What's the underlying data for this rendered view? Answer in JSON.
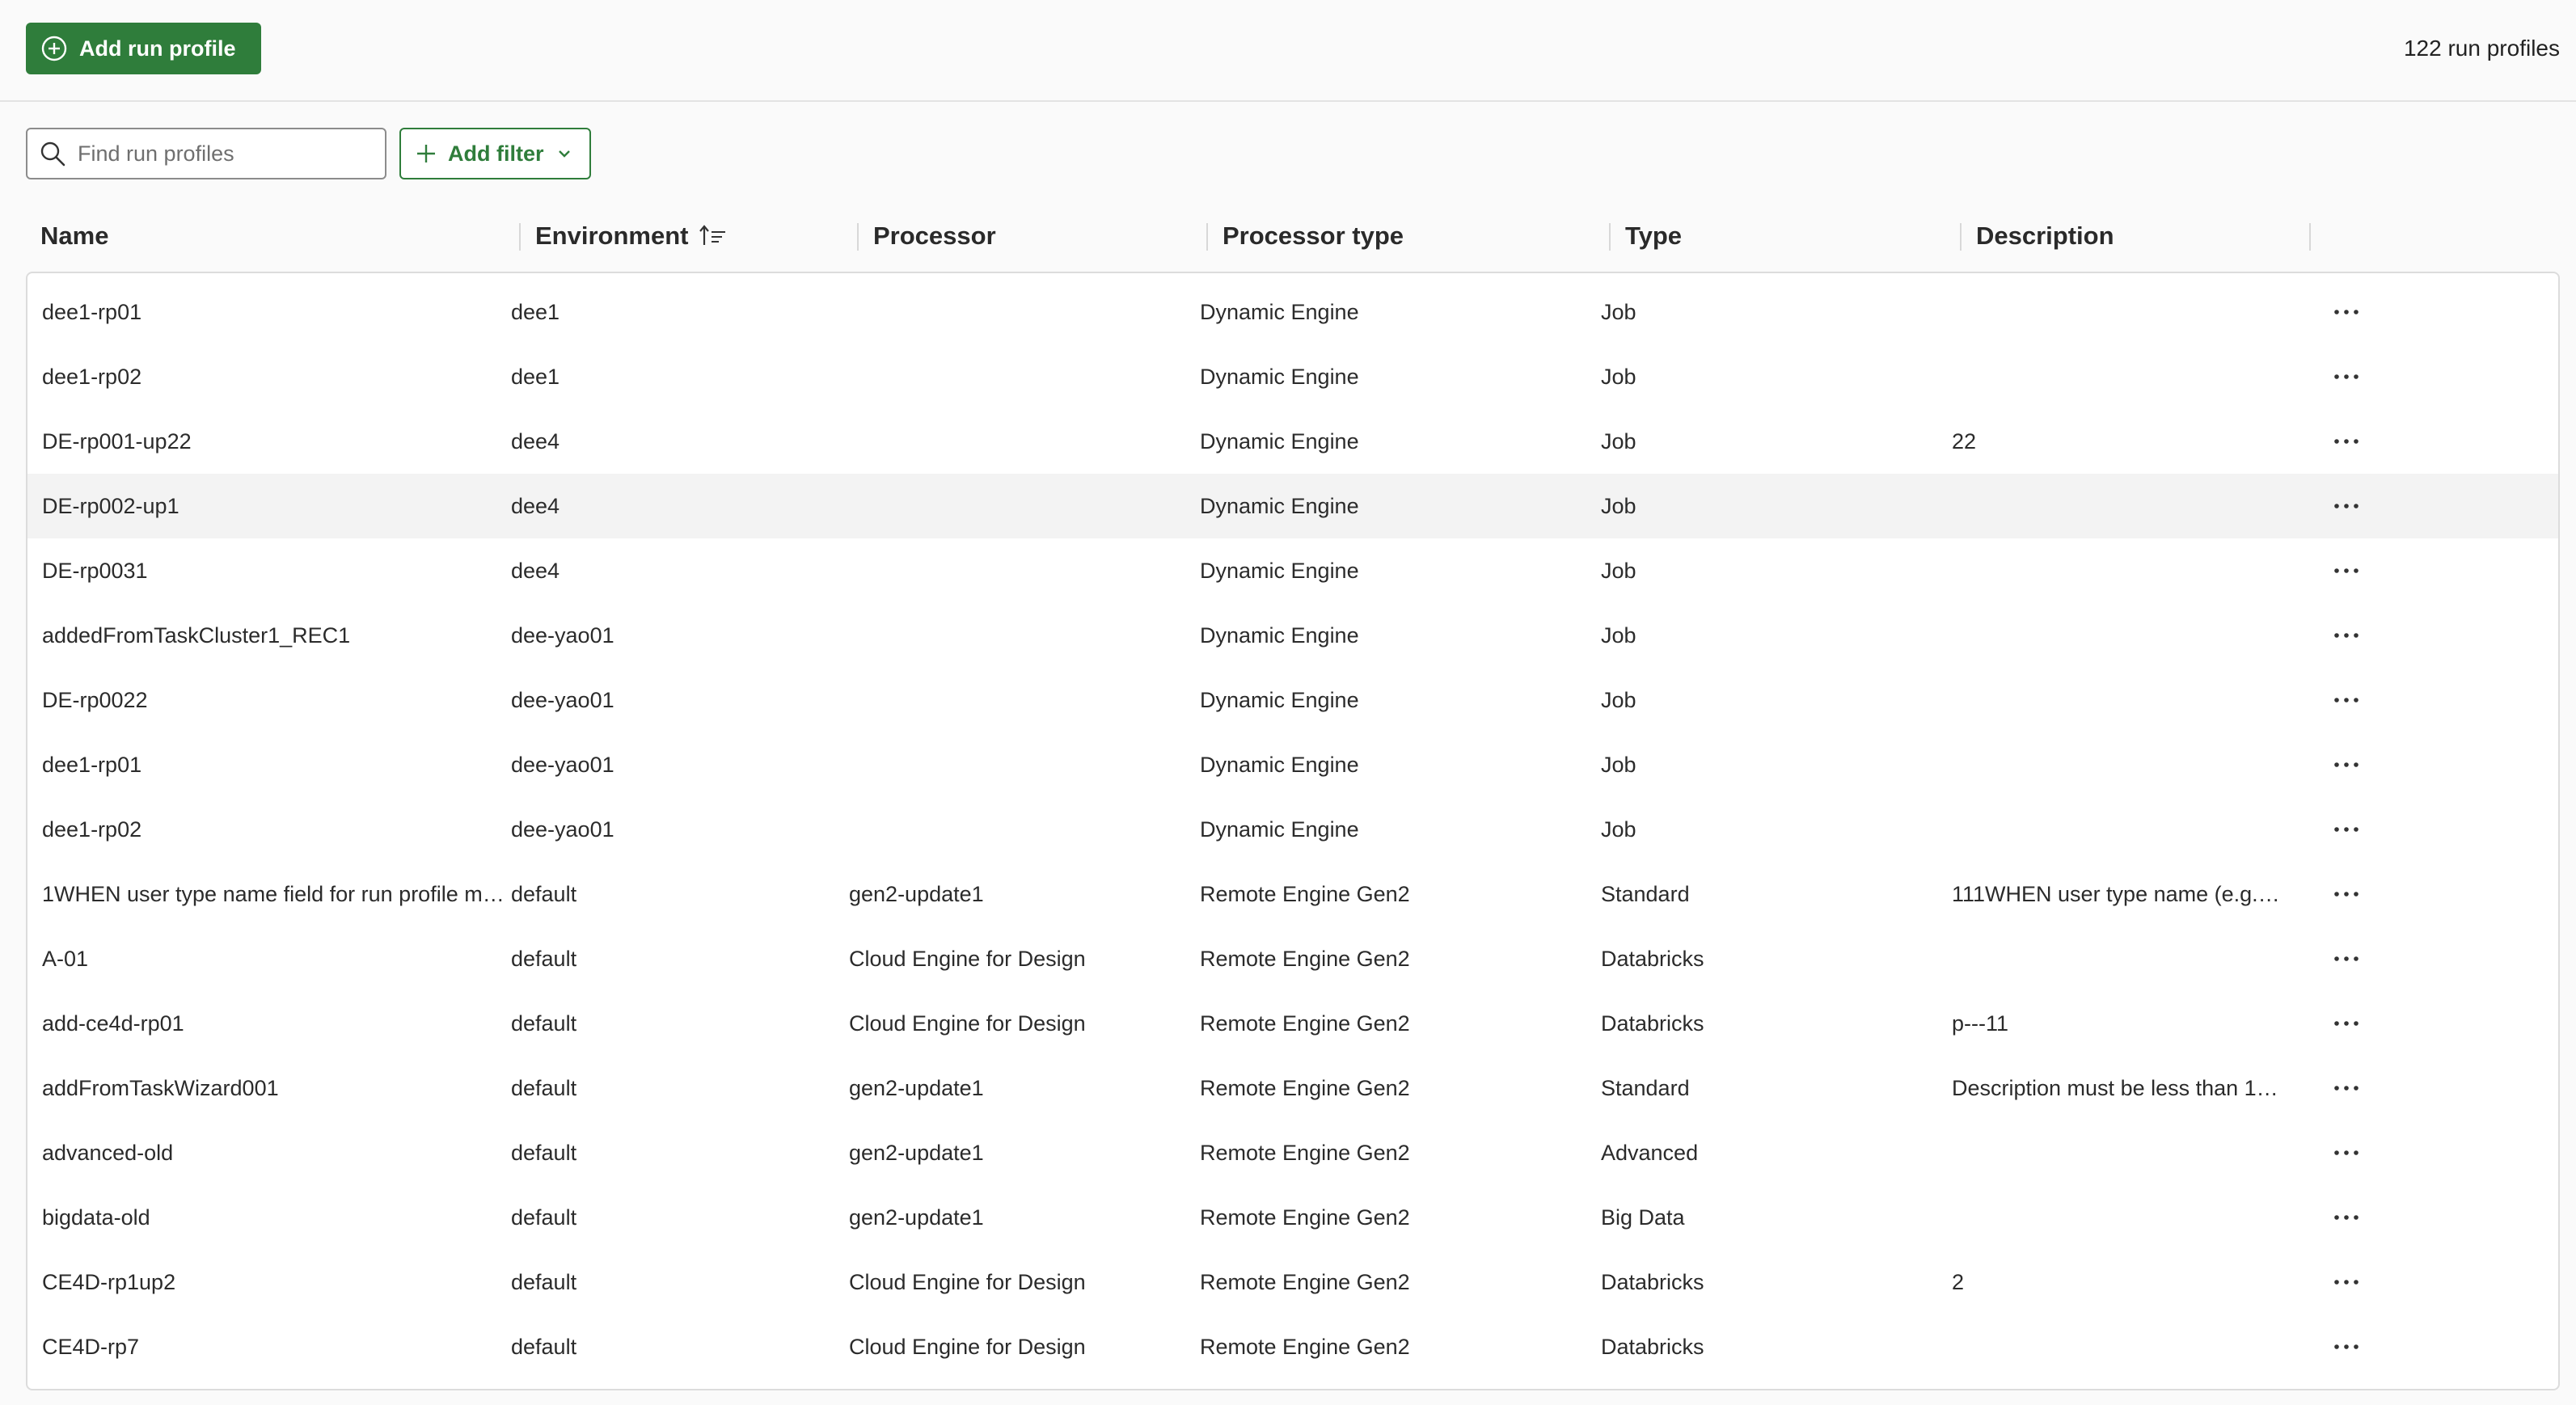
{
  "toolbar": {
    "add_label": "Add run profile",
    "count_label": "122 run profiles"
  },
  "search": {
    "placeholder": "Find run profiles",
    "value": ""
  },
  "filter": {
    "label": "Add filter"
  },
  "colors": {
    "accent": "#2f7d3b",
    "row_hover": "#f3f3f3"
  },
  "icons": {
    "add": "plus-circle-icon",
    "search": "search-icon",
    "filter": "plus-icon",
    "dropdown": "chevron-down-icon",
    "sort": "sort-ascending-icon",
    "actions": "more-horizontal-icon"
  },
  "table": {
    "columns": [
      "Name",
      "Environment",
      "Processor",
      "Processor type",
      "Type",
      "Description"
    ],
    "sorted_column": "Environment",
    "sort_direction": "ascending",
    "rows": [
      {
        "name": "dee1-rp01",
        "environment": "dee1",
        "processor": "",
        "processor_type": "Dynamic Engine",
        "type": "Job",
        "description": ""
      },
      {
        "name": "dee1-rp02",
        "environment": "dee1",
        "processor": "",
        "processor_type": "Dynamic Engine",
        "type": "Job",
        "description": ""
      },
      {
        "name": "DE-rp001-up22",
        "environment": "dee4",
        "processor": "",
        "processor_type": "Dynamic Engine",
        "type": "Job",
        "description": "22"
      },
      {
        "name": "DE-rp002-up1",
        "environment": "dee4",
        "processor": "",
        "processor_type": "Dynamic Engine",
        "type": "Job",
        "description": ""
      },
      {
        "name": "DE-rp0031",
        "environment": "dee4",
        "processor": "",
        "processor_type": "Dynamic Engine",
        "type": "Job",
        "description": ""
      },
      {
        "name": "addedFromTaskCluster1_REC1",
        "environment": "dee-yao01",
        "processor": "",
        "processor_type": "Dynamic Engine",
        "type": "Job",
        "description": ""
      },
      {
        "name": "DE-rp0022",
        "environment": "dee-yao01",
        "processor": "",
        "processor_type": "Dynamic Engine",
        "type": "Job",
        "description": ""
      },
      {
        "name": "dee1-rp01",
        "environment": "dee-yao01",
        "processor": "",
        "processor_type": "Dynamic Engine",
        "type": "Job",
        "description": ""
      },
      {
        "name": "dee1-rp02",
        "environment": "dee-yao01",
        "processor": "",
        "processor_type": "Dynamic Engine",
        "type": "Job",
        "description": ""
      },
      {
        "name": "1WHEN user type name field for run profile mor…",
        "environment": "default",
        "processor": "gen2-update1",
        "processor_type": "Remote Engine Gen2",
        "type": "Standard",
        "description": "111WHEN user type name (e.g. t…"
      },
      {
        "name": "A-01",
        "environment": "default",
        "processor": "Cloud Engine for Design",
        "processor_type": "Remote Engine Gen2",
        "type": "Databricks",
        "description": ""
      },
      {
        "name": "add-ce4d-rp01",
        "environment": "default",
        "processor": "Cloud Engine for Design",
        "processor_type": "Remote Engine Gen2",
        "type": "Databricks",
        "description": "p---11"
      },
      {
        "name": "addFromTaskWizard001",
        "environment": "default",
        "processor": "gen2-update1",
        "processor_type": "Remote Engine Gen2",
        "type": "Standard",
        "description": "Description must be less than 1…"
      },
      {
        "name": "advanced-old",
        "environment": "default",
        "processor": "gen2-update1",
        "processor_type": "Remote Engine Gen2",
        "type": "Advanced",
        "description": ""
      },
      {
        "name": "bigdata-old",
        "environment": "default",
        "processor": "gen2-update1",
        "processor_type": "Remote Engine Gen2",
        "type": "Big Data",
        "description": ""
      },
      {
        "name": "CE4D-rp1up2",
        "environment": "default",
        "processor": "Cloud Engine for Design",
        "processor_type": "Remote Engine Gen2",
        "type": "Databricks",
        "description": "2"
      },
      {
        "name": "CE4D-rp7",
        "environment": "default",
        "processor": "Cloud Engine for Design",
        "processor_type": "Remote Engine Gen2",
        "type": "Databricks",
        "description": ""
      }
    ]
  }
}
